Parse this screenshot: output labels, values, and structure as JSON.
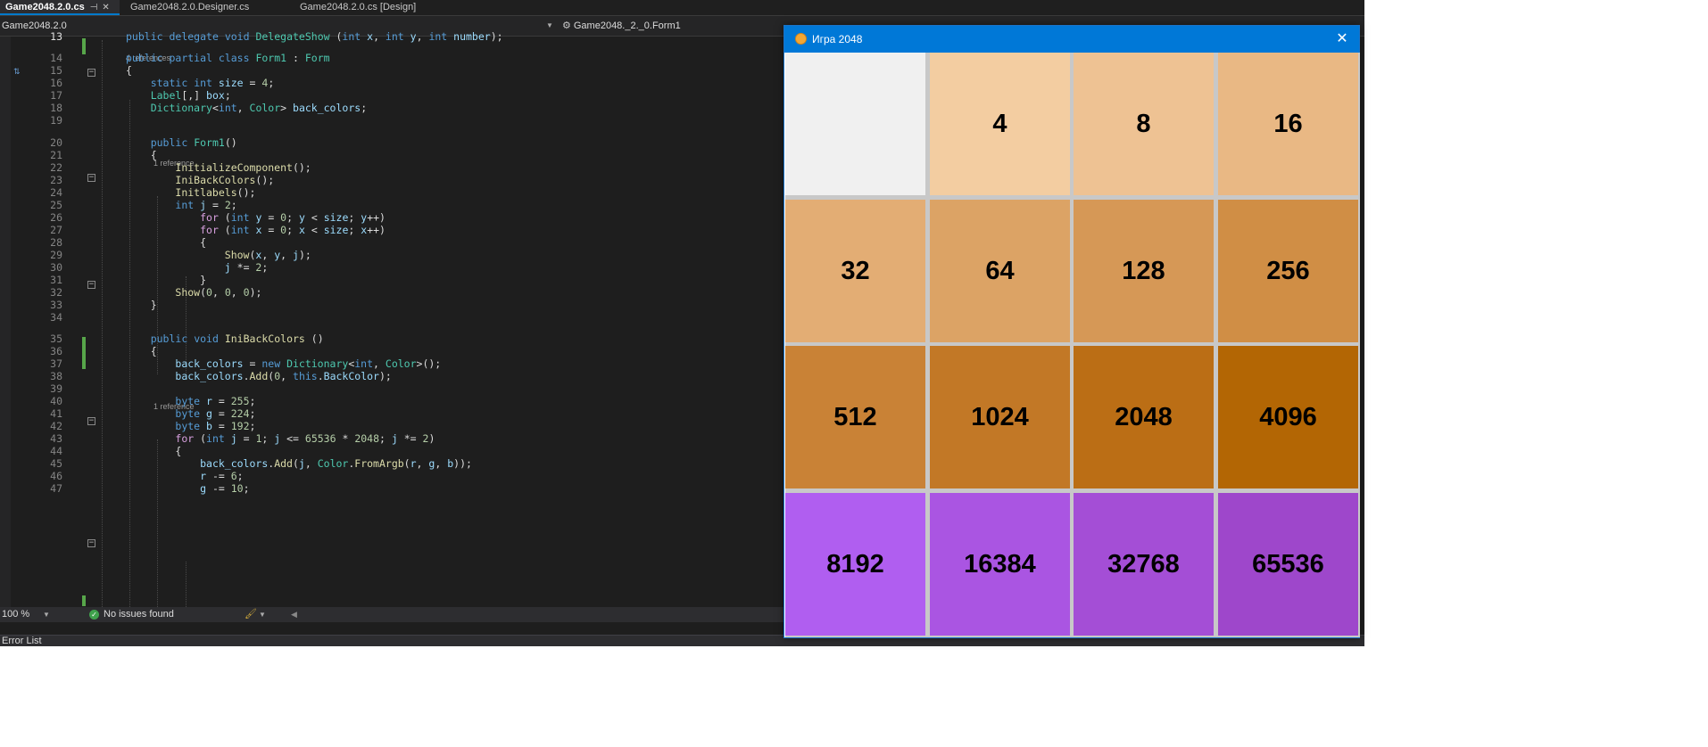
{
  "tabs": [
    {
      "label": "Game2048.2.0.cs",
      "active": true
    },
    {
      "label": "Game2048.2.0.Designer.cs",
      "active": false
    },
    {
      "label": "Game2048.2.0.cs [Design]",
      "active": false
    }
  ],
  "nav": {
    "project": "Game2048.2.0",
    "class_path": "Game2048._2._0.Form1"
  },
  "code": {
    "lines": [
      {
        "n": "13",
        "html": "<span class=\"kw\">public</span> <span class=\"kw\">delegate</span> <span class=\"kw\">void</span> <span class=\"ty\">DelegateShow</span> (<span class=\"kw\">int</span> <span class=\"vr\">x</span>, <span class=\"kw\">int</span> <span class=\"vr\">y</span>, <span class=\"kw\">int</span> <span class=\"vr\">number</span>);"
      },
      {
        "n": "14",
        "html": "<span class=\"kw\">public</span> <span class=\"kw\">partial</span> <span class=\"kw\">class</span> <span class=\"ty\">Form1</span> : <span class=\"ty\">Form</span>"
      },
      {
        "n": "15",
        "html": "{"
      },
      {
        "n": "16",
        "html": "    <span class=\"kw\">static</span> <span class=\"kw\">int</span> <span class=\"vr\">size</span> = <span class=\"nm\">4</span>;"
      },
      {
        "n": "17",
        "html": "    <span class=\"ty\">Label</span>[,] <span class=\"vr\">box</span>;"
      },
      {
        "n": "18",
        "html": "    <span class=\"ty\">Dictionary</span>&lt;<span class=\"kw\">int</span>, <span class=\"ty\">Color</span>&gt; <span class=\"vr\">back_colors</span>;"
      },
      {
        "n": "19",
        "html": ""
      },
      {
        "n": "20",
        "html": "    <span class=\"kw\">public</span> <span class=\"ty\">Form1</span>()"
      },
      {
        "n": "21",
        "html": "    {"
      },
      {
        "n": "22",
        "html": "        <span class=\"fn\">InitializeComponent</span>();"
      },
      {
        "n": "23",
        "html": "        <span class=\"fn\">IniBackColors</span>();"
      },
      {
        "n": "24",
        "html": "        <span class=\"fn\">Initlabels</span>();"
      },
      {
        "n": "25",
        "html": "        <span class=\"kw\">int</span> <span class=\"vr\">j</span> = <span class=\"nm\">2</span>;"
      },
      {
        "n": "26",
        "html": "            <span class=\"pr\">for</span> (<span class=\"kw\">int</span> <span class=\"vr\">y</span> = <span class=\"nm\">0</span>; <span class=\"vr\">y</span> &lt; <span class=\"vr\">size</span>; <span class=\"vr\">y</span>++)"
      },
      {
        "n": "27",
        "html": "            <span class=\"pr\">for</span> (<span class=\"kw\">int</span> <span class=\"vr\">x</span> = <span class=\"nm\">0</span>; <span class=\"vr\">x</span> &lt; <span class=\"vr\">size</span>; <span class=\"vr\">x</span>++)"
      },
      {
        "n": "28",
        "html": "            {"
      },
      {
        "n": "29",
        "html": "                <span class=\"fn\">Show</span>(<span class=\"vr\">x</span>, <span class=\"vr\">y</span>, <span class=\"vr\">j</span>);"
      },
      {
        "n": "30",
        "html": "                <span class=\"vr\">j</span> *= <span class=\"nm\">2</span>;"
      },
      {
        "n": "31",
        "html": "            }"
      },
      {
        "n": "32",
        "html": "        <span class=\"fn\">Show</span>(<span class=\"nm\">0</span>, <span class=\"nm\">0</span>, <span class=\"nm\">0</span>);"
      },
      {
        "n": "33",
        "html": "    }"
      },
      {
        "n": "34",
        "html": ""
      },
      {
        "n": "35",
        "html": "    <span class=\"kw\">public</span> <span class=\"kw\">void</span> <span class=\"fn\">IniBackColors</span> ()"
      },
      {
        "n": "36",
        "html": "    {"
      },
      {
        "n": "37",
        "html": "        <span class=\"vr\">back_colors</span> = <span class=\"kw\">new</span> <span class=\"ty\">Dictionary</span>&lt;<span class=\"kw\">int</span>, <span class=\"ty\">Color</span>&gt;();"
      },
      {
        "n": "38",
        "html": "        <span class=\"vr\">back_colors</span>.<span class=\"fn\">Add</span>(<span class=\"nm\">0</span>, <span class=\"kw\">this</span>.<span class=\"vr\">BackColor</span>);"
      },
      {
        "n": "39",
        "html": ""
      },
      {
        "n": "40",
        "html": "        <span class=\"kw\">byte</span> <span class=\"vr\">r</span> = <span class=\"nm\">255</span>;"
      },
      {
        "n": "41",
        "html": "        <span class=\"kw\">byte</span> <span class=\"vr\">g</span> = <span class=\"nm\">224</span>;"
      },
      {
        "n": "42",
        "html": "        <span class=\"kw\">byte</span> <span class=\"vr\">b</span> = <span class=\"nm\">192</span>;"
      },
      {
        "n": "43",
        "html": "        <span class=\"pr\">for</span> (<span class=\"kw\">int</span> <span class=\"vr\">j</span> = <span class=\"nm\">1</span>; <span class=\"vr\">j</span> &lt;= <span class=\"nm\">65536</span> * <span class=\"nm\">2048</span>; <span class=\"vr\">j</span> *= <span class=\"nm\">2</span>)"
      },
      {
        "n": "44",
        "html": "        {"
      },
      {
        "n": "45",
        "html": "            <span class=\"vr\">back_colors</span>.<span class=\"fn\">Add</span>(<span class=\"vr\">j</span>, <span class=\"ty\">Color</span>.<span class=\"fn\">FromArgb</span>(<span class=\"vr\">r</span>, <span class=\"vr\">g</span>, <span class=\"vr\">b</span>));"
      },
      {
        "n": "46",
        "html": "            <span class=\"vr\">r</span> -= <span class=\"nm\">6</span>;"
      },
      {
        "n": "47",
        "html": "            <span class=\"vr\">g</span> -= <span class=\"nm\">10</span>;"
      }
    ],
    "lens": {
      "before_14": "4 references",
      "before_20": "1 reference",
      "before_35": "1 reference"
    }
  },
  "status": {
    "zoom": "100 %",
    "issues": "No issues found"
  },
  "error_list": "Error List",
  "game": {
    "title": "Игра 2048",
    "tiles": [
      {
        "value": "",
        "color": "#f0f0f0"
      },
      {
        "value": "4",
        "color": "#f3cda1"
      },
      {
        "value": "8",
        "color": "#eec293"
      },
      {
        "value": "16",
        "color": "#e9b884"
      },
      {
        "value": "32",
        "color": "#e3ad74"
      },
      {
        "value": "64",
        "color": "#dca365"
      },
      {
        "value": "128",
        "color": "#d69856"
      },
      {
        "value": "256",
        "color": "#d08e45"
      },
      {
        "value": "512",
        "color": "#c98236"
      },
      {
        "value": "1024",
        "color": "#c27826"
      },
      {
        "value": "2048",
        "color": "#bb6e15"
      },
      {
        "value": "4096",
        "color": "#b36604"
      },
      {
        "value": "8192",
        "color": "#b05ef0"
      },
      {
        "value": "16384",
        "color": "#aa55e2"
      },
      {
        "value": "32768",
        "color": "#a44ed6"
      },
      {
        "value": "65536",
        "color": "#9e47cb"
      }
    ]
  }
}
